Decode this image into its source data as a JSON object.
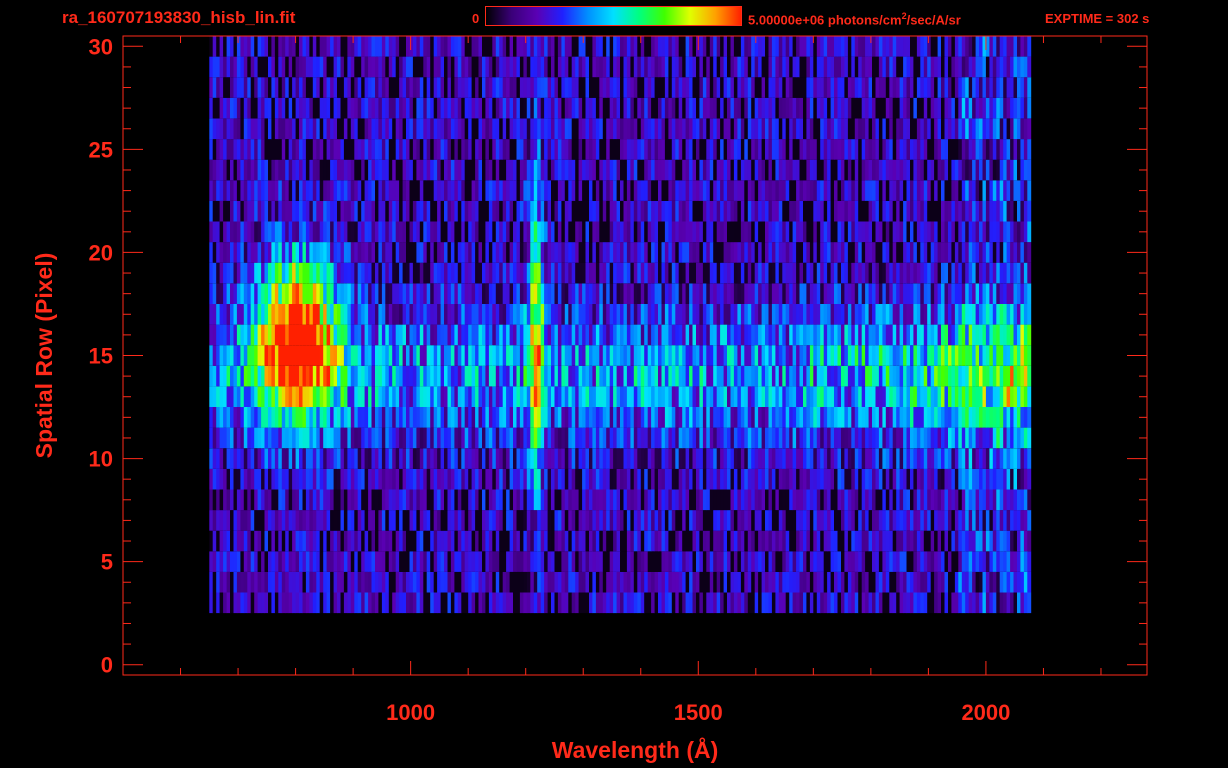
{
  "header": {
    "file_name": "ra_160707193830_hisb_lin.fit",
    "colorbar_min": "0",
    "colorbar_max_units_prefix": "5.00000e+06 photons/cm",
    "colorbar_units_sup": "2",
    "colorbar_units_suffix": "/sec/A/sr",
    "exptime": "EXPTIME = 302 s"
  },
  "colors": {
    "axis": "#ff2a1a",
    "background": "#000000",
    "colormap": [
      "#000000",
      "#3a0078",
      "#5a00b4",
      "#2020ff",
      "#0090ff",
      "#00e0ff",
      "#00ff80",
      "#40ff00",
      "#e0ff00",
      "#ffa000",
      "#ff2000"
    ]
  },
  "chart_data": {
    "type": "heatmap",
    "title": "ra_160707193830_hisb_lin.fit",
    "xlabel": "Wavelength (Å)",
    "ylabel": "Spatial Row (Pixel)",
    "xlim": [
      500,
      2280
    ],
    "ylim": [
      -0.5,
      30.5
    ],
    "xticks": [
      1000,
      1500,
      2000
    ],
    "yticks": [
      0,
      5,
      10,
      15,
      20,
      25,
      30
    ],
    "color_range": [
      0,
      5000000
    ],
    "color_units": "photons/cm^2/sec/A/sr",
    "data_extent_wavelength": [
      650,
      2075
    ],
    "data_extent_rows": [
      3,
      30
    ],
    "features": [
      {
        "name": "blob",
        "wavelength_center": 800,
        "wavelength_width": 70,
        "row_center": 16,
        "row_width": 3.5,
        "intensity": 1.0
      },
      {
        "name": "line",
        "wavelength_center": 1215,
        "wavelength_width": 14,
        "row_center": 16,
        "row_width": 7,
        "intensity": 0.6
      },
      {
        "name": "continuum",
        "wavelength_start": 1650,
        "wavelength_end": 2060,
        "row_center": 14,
        "row_width": 3,
        "intensity": 0.55
      }
    ]
  }
}
